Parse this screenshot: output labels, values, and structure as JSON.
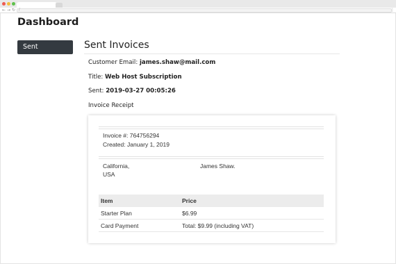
{
  "browser": {
    "url": "/",
    "back_glyph": "←",
    "forward_glyph": "→",
    "reload_glyph": "↻",
    "menu_glyph": "⋮"
  },
  "app": {
    "title": "Dashboard"
  },
  "sidebar": {
    "items": [
      {
        "label": "Sent",
        "active": true
      }
    ]
  },
  "main": {
    "heading": "Sent Invoices",
    "customer_email_label": "Customer Email:",
    "customer_email": "james.shaw@mail.com",
    "title_label": "Title:",
    "title": "Web Host Subscription",
    "sent_label": "Sent:",
    "sent": "2019-03-27 00:05:26",
    "receipt_heading": "Invoice Receipt"
  },
  "receipt": {
    "invoice_number_line": "Invoice #: 764756294",
    "created_line": "Created: January 1, 2019",
    "from_line1": "California,",
    "from_line2": "USA",
    "to_line1": "James Shaw.",
    "table": {
      "headers": [
        "Item",
        "Price"
      ],
      "rows": [
        [
          "Starter Plan",
          "$6.99"
        ],
        [
          "Card Payment",
          "Total: $9.99 (including VAT)"
        ]
      ]
    }
  },
  "colors": {
    "sidebar_active_bg": "#343a40",
    "table_header_bg": "#ececec"
  }
}
